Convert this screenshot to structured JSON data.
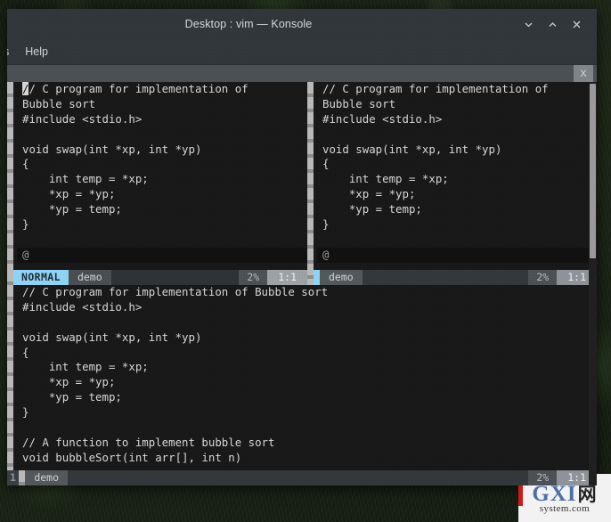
{
  "window": {
    "title": "Desktop : vim — Konsole",
    "controls": [
      {
        "name": "minimize-button",
        "glyph": "⌄"
      },
      {
        "name": "maximize-button",
        "glyph": "⌃"
      },
      {
        "name": "close-button",
        "glyph": "✕"
      }
    ]
  },
  "menubar": {
    "items": [
      {
        "label": "s",
        "clipped": true
      },
      {
        "label": "Help",
        "clipped": false
      }
    ]
  },
  "tabbar": {
    "close_label": "X"
  },
  "panes": {
    "top_left": {
      "lines": [
        "// C program for implementation of",
        "Bubble sort",
        "#include <stdio.h>",
        "",
        "void swap(int *xp, int *yp)",
        "{",
        "    int temp = *xp;",
        "    *xp = *yp;",
        "    *yp = temp;",
        "}"
      ],
      "continuation_marker": "@",
      "cursor_char": "/",
      "status": {
        "mode": "NORMAL",
        "file": "demo",
        "percent": "2%",
        "position": "1:1"
      }
    },
    "top_right": {
      "lines": [
        "// C program for implementation of",
        "Bubble sort",
        "#include <stdio.h>",
        "",
        "void swap(int *xp, int *yp)",
        "{",
        "    int temp = *xp;",
        "    *xp = *yp;",
        "    *yp = temp;",
        "}"
      ],
      "continuation_marker": "@",
      "status": {
        "mode": "",
        "file": "demo",
        "percent": "2%",
        "position": "1:1"
      }
    },
    "bottom": {
      "lines": [
        "// C program for implementation of Bubble sort",
        "#include <stdio.h>",
        "",
        "void swap(int *xp, int *yp)",
        "{",
        "    int temp = *xp;",
        "    *xp = *yp;",
        "    *yp = temp;",
        "}",
        "",
        "// A function to implement bubble sort",
        "void bubbleSort(int arr[], int n)"
      ],
      "status": {
        "left_edge": "1",
        "file": "demo",
        "percent": "2%",
        "position": "1:1"
      }
    }
  },
  "watermark": {
    "main": "GXI",
    "cn": "网",
    "sub": "system.com"
  },
  "colors": {
    "titlebar": "#31363b",
    "terminal_bg": "#181818",
    "terminal_fg": "#d6d6d6",
    "mode_badge": "#8ed3f4",
    "separator": "#b9b9b9",
    "tab_strip": "#4b5055"
  }
}
